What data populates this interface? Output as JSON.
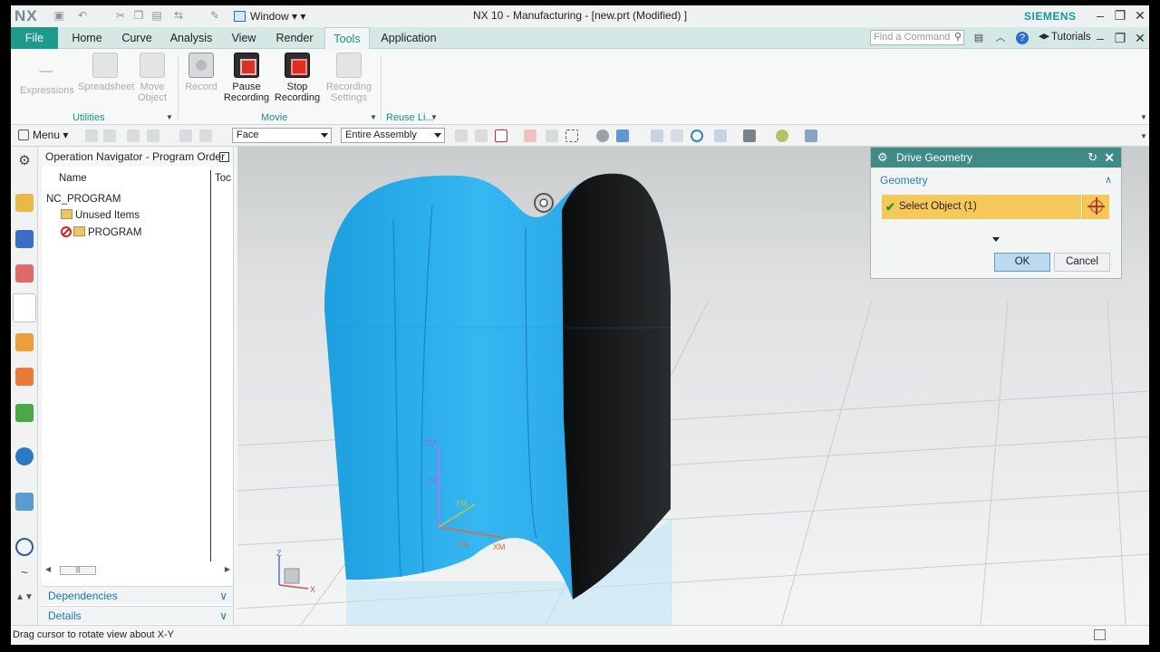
{
  "app": {
    "logo": "NX",
    "title": "NX 10 - Manufacturing - [new.prt (Modified) ]",
    "brand": "SIEMENS",
    "window_menu": "Window"
  },
  "tabs": [
    {
      "label": "File"
    },
    {
      "label": "Home"
    },
    {
      "label": "Curve"
    },
    {
      "label": "Analysis"
    },
    {
      "label": "View"
    },
    {
      "label": "Render"
    },
    {
      "label": "Tools"
    },
    {
      "label": "Application"
    }
  ],
  "active_tab": "Tools",
  "search": {
    "placeholder": "Find a Command"
  },
  "tutorials": "Tutorials",
  "ribbon": {
    "utilities": {
      "label": "Utilities",
      "buttons": [
        {
          "label": "Expressions",
          "enabled": false
        },
        {
          "label": "Spreadsheet",
          "enabled": false
        },
        {
          "label": "Move Object",
          "enabled": false
        }
      ]
    },
    "movie": {
      "label": "Movie",
      "buttons": [
        {
          "label": "Record",
          "enabled": false
        },
        {
          "label": "Pause Recording",
          "enabled": true
        },
        {
          "label": "Stop Recording",
          "enabled": true
        },
        {
          "label": "Recording Settings",
          "enabled": false
        }
      ]
    },
    "reuse": {
      "label": "Reuse Li..."
    }
  },
  "toolbar": {
    "menu": "Menu",
    "filter": "Face",
    "scope": "Entire Assembly"
  },
  "navigator": {
    "title": "Operation Navigator - Program Order",
    "columns": [
      "Name",
      "Toc"
    ],
    "items": [
      "NC_PROGRAM",
      "Unused Items",
      "PROGRAM"
    ],
    "panels": [
      "Dependencies",
      "Details"
    ]
  },
  "viewport": {
    "wcs_labels": [
      "ZM",
      "ZC",
      "YM",
      "XC",
      "XM"
    ],
    "triad_labels": [
      "Z",
      "X"
    ]
  },
  "dialog": {
    "title": "Drive Geometry",
    "section": "Geometry",
    "select_label": "Select Object (1)",
    "ok": "OK",
    "cancel": "Cancel"
  },
  "status": "Drag cursor to rotate view about X-Y",
  "colors": {
    "accent": "#1d9a8a",
    "dialog_header": "#3f8c87",
    "part_blue": "#2aa9e6",
    "highlight_yellow": "#f6c85a"
  }
}
